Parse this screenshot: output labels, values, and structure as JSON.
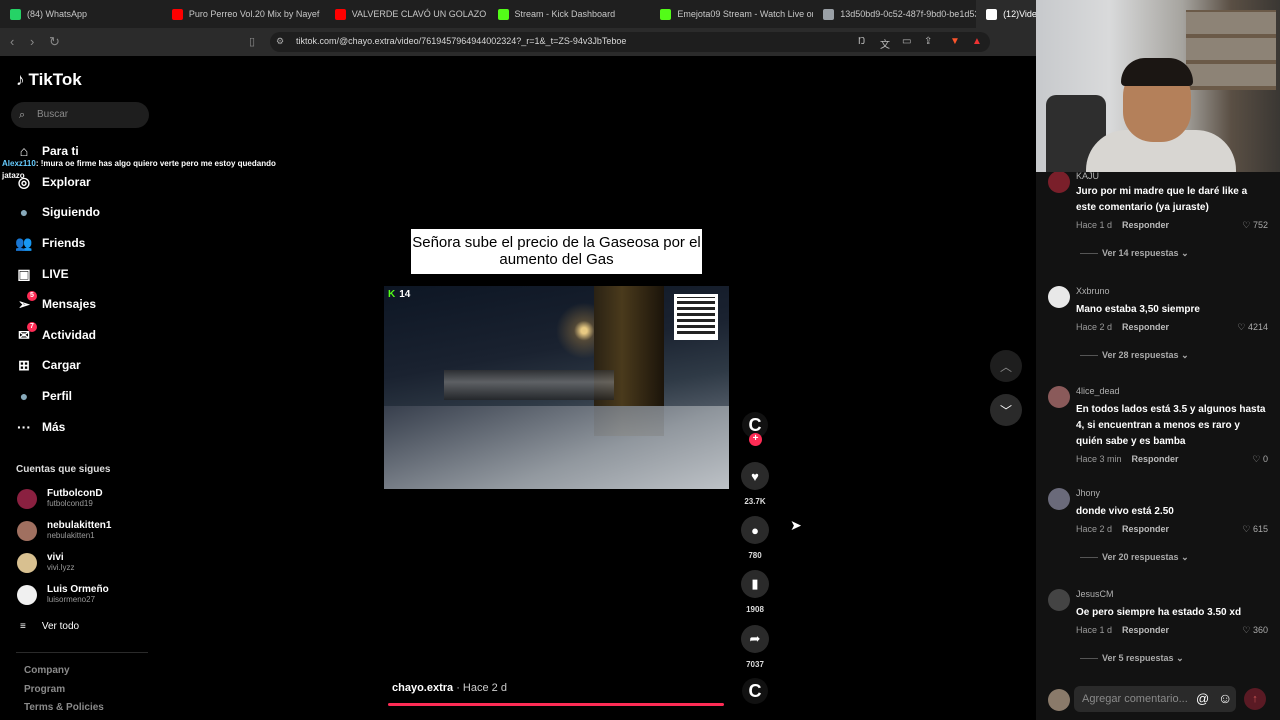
{
  "browser": {
    "tabs": [
      {
        "label": "(84) WhatsApp",
        "color": "#25d366"
      },
      {
        "label": "Puro Perreo Vol.20 Mix by Nayef",
        "color": "#ff0000"
      },
      {
        "label": "VALVERDE CLAVÓ UN GOLAZO DE T",
        "color": "#ff0000"
      },
      {
        "label": "Stream - Kick Dashboard",
        "color": "#53fc18"
      },
      {
        "label": "Emejota09 Stream - Watch Live on K",
        "color": "#53fc18"
      },
      {
        "label": "13d50bd9-0c52-487f-9bd0-be1d53",
        "color": "#9aa0a6"
      },
      {
        "label": "(12)Video",
        "color": "#ffffff"
      }
    ],
    "url": "tiktok.com/@chayo.extra/video/7619457964944002324?_r=1&_t=ZS-94v3JbTeboe"
  },
  "sidebar": {
    "logo": "TikTok",
    "search_placeholder": "Buscar",
    "nav": [
      {
        "label": "Para ti",
        "icon": "home-icon",
        "glyph": "⌂"
      },
      {
        "label": "Explorar",
        "icon": "compass-icon",
        "glyph": "◎"
      },
      {
        "label": "Siguiendo",
        "icon": "following-icon",
        "glyph": "●"
      },
      {
        "label": "Friends",
        "icon": "friends-icon",
        "glyph": "👥"
      },
      {
        "label": "LIVE",
        "icon": "live-icon",
        "glyph": "▣"
      },
      {
        "label": "Mensajes",
        "icon": "messages-icon",
        "glyph": "➢",
        "badge": "5"
      },
      {
        "label": "Actividad",
        "icon": "activity-icon",
        "glyph": "✉",
        "badge": "7"
      },
      {
        "label": "Cargar",
        "icon": "upload-icon",
        "glyph": "⊞"
      },
      {
        "label": "Perfil",
        "icon": "profile-icon",
        "glyph": "●"
      },
      {
        "label": "Más",
        "icon": "more-icon",
        "glyph": "···"
      }
    ],
    "chat_user": "Alexz110",
    "chat_message": ": !mura oe firme has algo quiero verte pero me estoy quedando jatazo",
    "following_title": "Cuentas que sigues",
    "following": [
      {
        "name": "FutbolconD",
        "handle": "futbolcond19",
        "color": "#8a2040"
      },
      {
        "name": "nebulakitten1",
        "handle": "nebulakitten1",
        "color": "#a07060"
      },
      {
        "name": "vivi",
        "handle": "vivi.lyzz",
        "color": "#d8c090"
      },
      {
        "name": "Luis Ormeño",
        "handle": "luisormeno27",
        "color": "#f0f0f0"
      }
    ],
    "see_all": "Ver todo",
    "footer": [
      "Company",
      "Program",
      "Terms & Policies"
    ]
  },
  "video": {
    "caption": "Señora sube el precio de la Gaseosa por el aumento del Gas",
    "kick_count": "14",
    "author": "chayo.extra",
    "time": " · Hace 2 d"
  },
  "actions": {
    "likes": "23.7K",
    "comments": "780",
    "saves": "1908",
    "shares": "7037"
  },
  "comments": [
    {
      "user": "KAJU",
      "text": "Juro por mi madre que le daré like a este comentario (ya juraste)",
      "time": "Hace 1 d",
      "likes": "752",
      "more": "Ver 14 respuestas",
      "color": "#7a1f2a"
    },
    {
      "user": "Xxbruno",
      "text": "Mano estaba 3,50 siempre",
      "time": "Hace 2 d",
      "likes": "4214",
      "more": "Ver 28 respuestas",
      "color": "#e8e8e8"
    },
    {
      "user": "4lice_dead",
      "text": "En todos lados está 3.5 y algunos hasta 4, si encuentran a menos es raro y quién sabe y es bamba",
      "time": "Hace 3 min",
      "likes": "0",
      "more": "",
      "color": "#8a5a5a"
    },
    {
      "user": "Jhony",
      "text": "donde vivo está 2.50",
      "time": "Hace 2 d",
      "likes": "615",
      "more": "Ver 20 respuestas",
      "color": "#6a6a7a"
    },
    {
      "user": "JesusCM",
      "text": "Oe pero siempre ha estado 3.50 xd",
      "time": "Hace 1 d",
      "likes": "360",
      "more": "Ver 5 respuestas",
      "color": "#444"
    }
  ],
  "reply_label": "Responder",
  "comment_placeholder": "Agregar comentario..."
}
